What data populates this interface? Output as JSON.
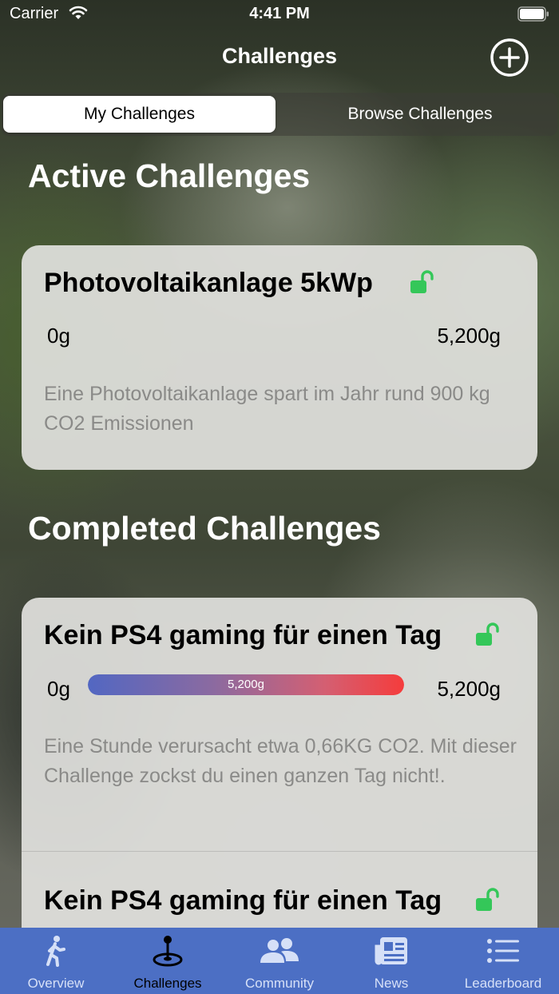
{
  "status_bar": {
    "carrier": "Carrier",
    "time": "4:41 PM"
  },
  "nav": {
    "title": "Challenges",
    "add_icon": "plus-circle-icon"
  },
  "segments": {
    "active": "My Challenges",
    "inactive": "Browse Challenges"
  },
  "active_section": {
    "title": "Active Challenges",
    "items": [
      {
        "title": "Photovoltaikanlage 5kWp",
        "min": "0g",
        "max": "5,200g",
        "progress_fraction": 0.0,
        "progress_label": "",
        "description": "Eine Photovoltaikanlage spart im Jahr rund 900 kg CO2 Emissionen"
      }
    ]
  },
  "completed_section": {
    "title": "Completed Challenges",
    "items": [
      {
        "title": "Kein PS4 gaming für einen Tag",
        "min": "0g",
        "max": "5,200g",
        "progress_fraction": 1.0,
        "progress_label": "5,200g",
        "description": "Eine Stunde verursacht etwa 0,66KG CO2. Mit dieser Challenge zockst du einen ganzen Tag nicht!."
      },
      {
        "title": "Kein PS4 gaming für einen Tag"
      }
    ]
  },
  "tabs": [
    {
      "label": "Overview",
      "icon": "walking-person-icon",
      "active": false
    },
    {
      "label": "Challenges",
      "icon": "joystick-icon",
      "active": true
    },
    {
      "label": "Community",
      "icon": "people-icon",
      "active": false
    },
    {
      "label": "News",
      "icon": "newspaper-icon",
      "active": false
    },
    {
      "label": "Leaderboard",
      "icon": "list-icon",
      "active": false
    }
  ],
  "colors": {
    "tab_bar": "#4c6fc4",
    "lock_green": "#34c759",
    "progress_start": "#5267c2",
    "progress_end": "#f53c3c"
  }
}
